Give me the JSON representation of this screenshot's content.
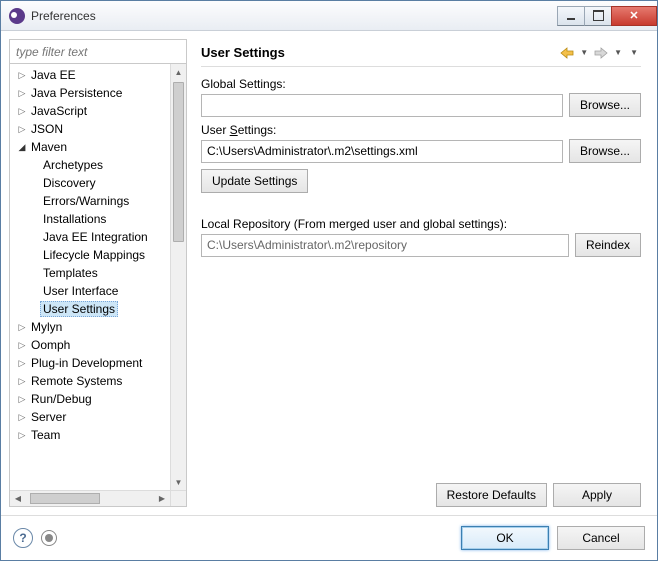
{
  "window": {
    "title": "Preferences"
  },
  "filter": {
    "placeholder": "type filter text"
  },
  "tree": {
    "items": [
      {
        "label": "Java EE",
        "expandable": true,
        "expanded": false,
        "depth": 0
      },
      {
        "label": "Java Persistence",
        "expandable": true,
        "expanded": false,
        "depth": 0
      },
      {
        "label": "JavaScript",
        "expandable": true,
        "expanded": false,
        "depth": 0
      },
      {
        "label": "JSON",
        "expandable": true,
        "expanded": false,
        "depth": 0
      },
      {
        "label": "Maven",
        "expandable": true,
        "expanded": true,
        "depth": 0
      },
      {
        "label": "Archetypes",
        "expandable": false,
        "depth": 1
      },
      {
        "label": "Discovery",
        "expandable": false,
        "depth": 1
      },
      {
        "label": "Errors/Warnings",
        "expandable": false,
        "depth": 1
      },
      {
        "label": "Installations",
        "expandable": false,
        "depth": 1
      },
      {
        "label": "Java EE Integration",
        "expandable": false,
        "depth": 1
      },
      {
        "label": "Lifecycle Mappings",
        "expandable": false,
        "depth": 1
      },
      {
        "label": "Templates",
        "expandable": false,
        "depth": 1
      },
      {
        "label": "User Interface",
        "expandable": false,
        "depth": 1
      },
      {
        "label": "User Settings",
        "expandable": false,
        "depth": 1,
        "selected": true
      },
      {
        "label": "Mylyn",
        "expandable": true,
        "expanded": false,
        "depth": 0
      },
      {
        "label": "Oomph",
        "expandable": true,
        "expanded": false,
        "depth": 0
      },
      {
        "label": "Plug-in Development",
        "expandable": true,
        "expanded": false,
        "depth": 0
      },
      {
        "label": "Remote Systems",
        "expandable": true,
        "expanded": false,
        "depth": 0
      },
      {
        "label": "Run/Debug",
        "expandable": true,
        "expanded": false,
        "depth": 0
      },
      {
        "label": "Server",
        "expandable": true,
        "expanded": false,
        "depth": 0
      },
      {
        "label": "Team",
        "expandable": true,
        "expanded": false,
        "depth": 0
      }
    ]
  },
  "page": {
    "title": "User Settings",
    "global_label": "Global Settings:",
    "global_value": "",
    "user_label_pre": "User ",
    "user_label_underline": "S",
    "user_label_post": "ettings:",
    "user_value": "C:\\Users\\Administrator\\.m2\\settings.xml",
    "browse_label": "Browse...",
    "update_label": "Update Settings",
    "local_repo_label": "Local Repository (From merged user and global settings):",
    "local_repo_value": "C:\\Users\\Administrator\\.m2\\repository",
    "reindex_label": "Reindex",
    "restore_label": "Restore Defaults",
    "apply_label": "Apply"
  },
  "footer": {
    "ok_label": "OK",
    "cancel_label": "Cancel"
  }
}
